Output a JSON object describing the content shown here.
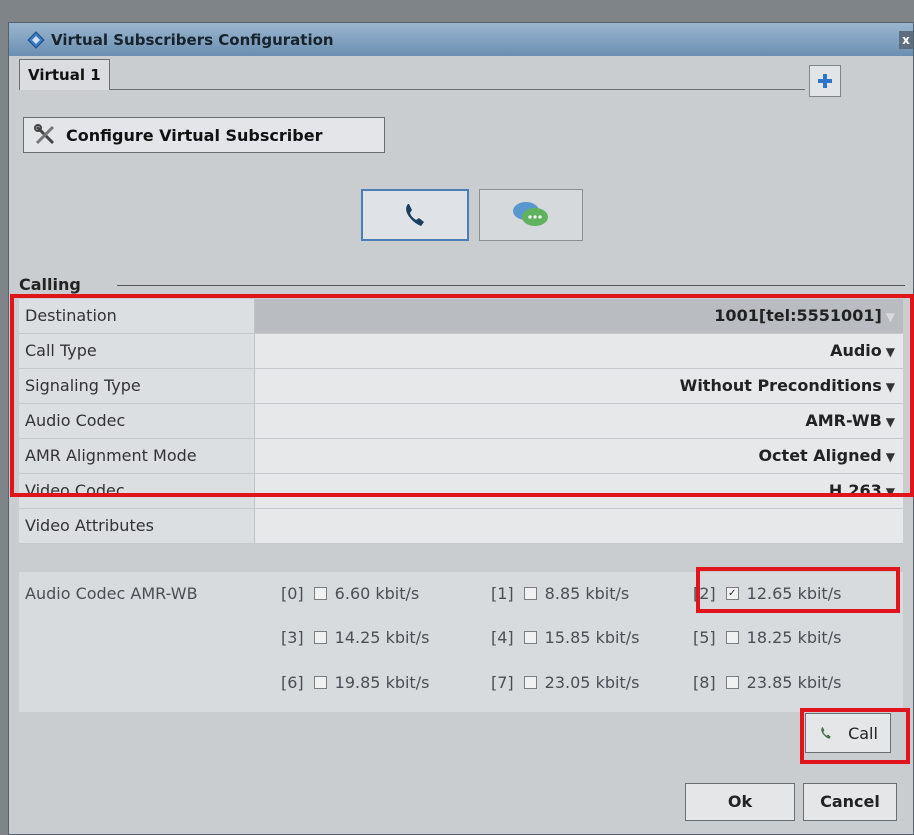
{
  "window": {
    "title": "Virtual Subscribers Configuration",
    "close_label": "x"
  },
  "tabs": [
    {
      "label": "Virtual 1",
      "selected": true
    }
  ],
  "add_button_label": "+",
  "configure_button": {
    "label": "Configure Virtual Subscriber",
    "icon": "tools-icon"
  },
  "modes": [
    {
      "name": "voice-call",
      "icon": "phone-icon",
      "selected": true
    },
    {
      "name": "messaging",
      "icon": "chat-bubbles-icon",
      "selected": false
    }
  ],
  "section": {
    "title": "Calling"
  },
  "fields": [
    {
      "label": "Destination",
      "value": "1001[tel:5551001]"
    },
    {
      "label": "Call Type",
      "value": "Audio"
    },
    {
      "label": "Signaling Type",
      "value": "Without Preconditions"
    },
    {
      "label": "Audio Codec",
      "value": "AMR-WB"
    },
    {
      "label": "AMR Alignment Mode",
      "value": "Octet Aligned"
    },
    {
      "label": "Video Codec",
      "value": "H.263"
    },
    {
      "label": "Video Attributes",
      "value": ""
    }
  ],
  "codec_rates": {
    "label": "Audio Codec AMR-WB",
    "rates": [
      {
        "index": "[0]",
        "rate": "6.60 kbit/s",
        "checked": false
      },
      {
        "index": "[1]",
        "rate": "8.85 kbit/s",
        "checked": false
      },
      {
        "index": "[2]",
        "rate": "12.65 kbit/s",
        "checked": true
      },
      {
        "index": "[3]",
        "rate": "14.25 kbit/s",
        "checked": false
      },
      {
        "index": "[4]",
        "rate": "15.85 kbit/s",
        "checked": false
      },
      {
        "index": "[5]",
        "rate": "18.25 kbit/s",
        "checked": false
      },
      {
        "index": "[6]",
        "rate": "19.85 kbit/s",
        "checked": false
      },
      {
        "index": "[7]",
        "rate": "23.05 kbit/s",
        "checked": false
      },
      {
        "index": "[8]",
        "rate": "23.85 kbit/s",
        "checked": false
      }
    ]
  },
  "buttons": {
    "call": "Call",
    "ok": "Ok",
    "cancel": "Cancel"
  },
  "colors": {
    "highlight": "#e1141b",
    "titlebar": "#7d9dbc",
    "accent_blue": "#2f76c8"
  }
}
